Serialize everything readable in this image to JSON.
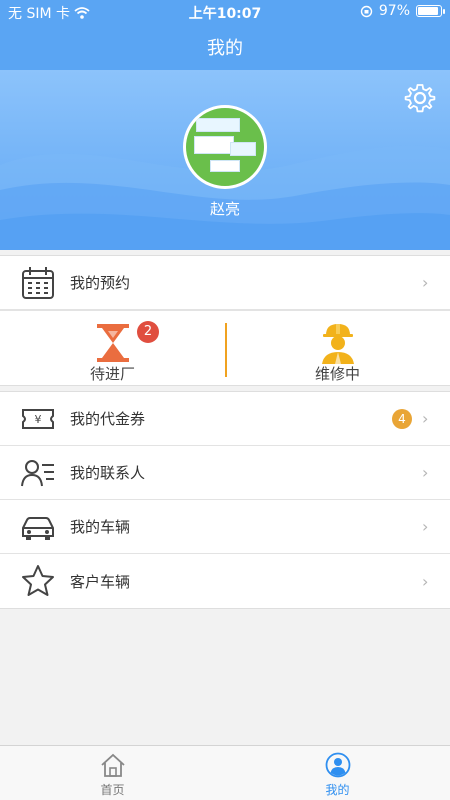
{
  "status_bar": {
    "carrier": "无 SIM 卡",
    "time": "上午10:07",
    "battery": "97%"
  },
  "nav": {
    "title": "我的"
  },
  "profile": {
    "username": "赵亮"
  },
  "appointment": {
    "label": "我的预约"
  },
  "progress": {
    "waiting": {
      "label": "待进厂",
      "badge": "2"
    },
    "repairing": {
      "label": "维修中"
    }
  },
  "menu": {
    "voucher": {
      "label": "我的代金券",
      "badge": "4"
    },
    "contacts": {
      "label": "我的联系人"
    },
    "vehicles": {
      "label": "我的车辆"
    },
    "customer_vehicles": {
      "label": "客户车辆"
    }
  },
  "tabs": {
    "home": "首页",
    "mine": "我的"
  },
  "colors": {
    "primary": "#5aa5f3",
    "accent_orange": "#f0a220",
    "badge_red": "#e04e3f",
    "badge_orange": "#e9a536"
  },
  "chevron": "›"
}
